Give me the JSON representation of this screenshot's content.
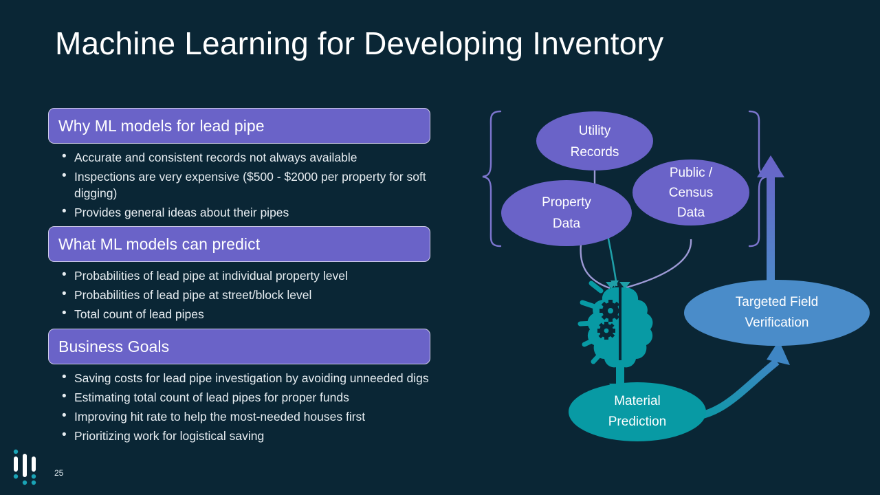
{
  "slide": {
    "title": "Machine Learning for Developing Inventory",
    "page_number": "25",
    "background_color": "#0a2635",
    "accent_purple": "#6a63c8",
    "accent_teal": "#069aa2",
    "accent_blue": "#4a8cc9"
  },
  "sections": [
    {
      "header": "Why ML models for lead pipe",
      "bullets": [
        "Accurate and consistent records not always available",
        "Inspections are very expensive ($500 - $2000 per property for soft digging)",
        "Provides general ideas about their pipes"
      ]
    },
    {
      "header": "What ML models can predict",
      "bullets": [
        "Probabilities of lead pipe at individual property level",
        "Probabilities of lead pipe at street/block level",
        "Total count of lead pipes"
      ]
    },
    {
      "header": "Business Goals",
      "bullets": [
        "Saving costs for lead pipe investigation by avoiding unneeded digs",
        "Estimating total count of lead pipes for proper funds",
        "Improving hit rate to help the most-needed houses first",
        "Prioritizing work for logistical saving"
      ]
    }
  ],
  "diagram": {
    "nodes": {
      "utility_records": {
        "line1": "Utility",
        "line2": "Records",
        "color": "#6a63c8"
      },
      "property_data": {
        "line1": "Property",
        "line2": "Data",
        "color": "#6a63c8"
      },
      "public_census_data": {
        "line1": "Public /",
        "line2": "Census",
        "line3": "Data",
        "color": "#6a63c8"
      },
      "ml_model": {
        "icon": "brain-gears-icon",
        "color": "#069aa2"
      },
      "material_prediction": {
        "line1": "Material",
        "line2": "Prediction",
        "color": "#069aa2"
      },
      "targeted_field_verification": {
        "line1": "Targeted Field",
        "line2": "Verification",
        "color": "#4a8cc9"
      }
    },
    "connectors": [
      {
        "name": "utility-to-model",
        "from": "utility_records",
        "to": "ml_model",
        "style": "curve"
      },
      {
        "name": "property-to-model",
        "from": "property_data",
        "to": "ml_model",
        "style": "curve"
      },
      {
        "name": "census-to-model",
        "from": "public_census_data",
        "to": "ml_model",
        "style": "curve"
      },
      {
        "name": "model-to-material-prediction",
        "from": "ml_model",
        "to": "material_prediction",
        "style": "arrow-down"
      },
      {
        "name": "material-to-verification",
        "from": "material_prediction",
        "to": "targeted_field_verification",
        "style": "curved-arrow"
      },
      {
        "name": "verification-to-data-sources",
        "from": "targeted_field_verification",
        "to": "data_sources_brace",
        "style": "big-arrow-up"
      }
    ],
    "braces": [
      {
        "name": "left-brace",
        "orientation": "left"
      },
      {
        "name": "right-brace",
        "orientation": "right"
      }
    ]
  },
  "logo": {
    "name": "company-logo",
    "bar_color": "#ffffff",
    "dot_color": "#1aa3b5"
  }
}
